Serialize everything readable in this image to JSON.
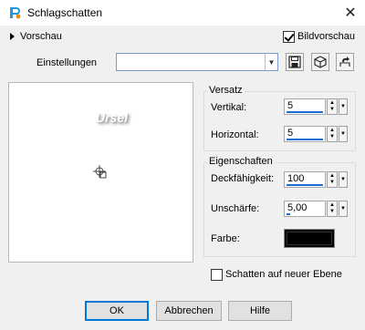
{
  "window": {
    "title": "Schlagschatten"
  },
  "preview": {
    "label": "Vorschau",
    "sample_text": "Ursel"
  },
  "bildvorschau": {
    "label": "Bildvorschau",
    "checked": true
  },
  "einstellungen": {
    "label": "Einstellungen",
    "value": ""
  },
  "versatz": {
    "title": "Versatz",
    "vertikal": {
      "label": "Vertikal:",
      "value": "5"
    },
    "horizontal": {
      "label": "Horizontal:",
      "value": "5"
    }
  },
  "eigenschaften": {
    "title": "Eigenschaften",
    "deckfaehigkeit": {
      "label": "Deckfähigkeit:",
      "value": "100"
    },
    "unschaerfe": {
      "label": "Unschärfe:",
      "value": "5,00"
    },
    "farbe": {
      "label": "Farbe:",
      "color": "#000000"
    }
  },
  "schatten_neue_ebene": {
    "label": "Schatten auf neuer Ebene",
    "checked": false
  },
  "buttons": {
    "ok": "OK",
    "cancel": "Abbrechen",
    "help": "Hilfe"
  },
  "colors": {
    "accent": "#0078d7",
    "bar": "#1a6fd6"
  }
}
